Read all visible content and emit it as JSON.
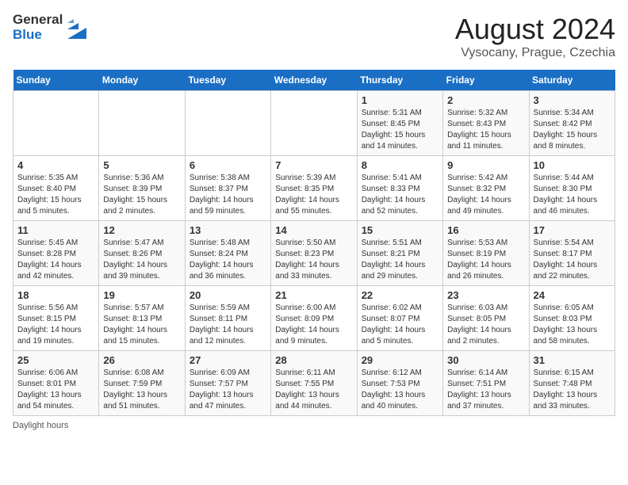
{
  "header": {
    "logo_line1": "General",
    "logo_line2": "Blue",
    "month_year": "August 2024",
    "location": "Vysocany, Prague, Czechia"
  },
  "footer": {
    "text": "Daylight hours"
  },
  "weekdays": [
    "Sunday",
    "Monday",
    "Tuesday",
    "Wednesday",
    "Thursday",
    "Friday",
    "Saturday"
  ],
  "weeks": [
    [
      {
        "day": "",
        "info": ""
      },
      {
        "day": "",
        "info": ""
      },
      {
        "day": "",
        "info": ""
      },
      {
        "day": "",
        "info": ""
      },
      {
        "day": "1",
        "info": "Sunrise: 5:31 AM\nSunset: 8:45 PM\nDaylight: 15 hours\nand 14 minutes."
      },
      {
        "day": "2",
        "info": "Sunrise: 5:32 AM\nSunset: 8:43 PM\nDaylight: 15 hours\nand 11 minutes."
      },
      {
        "day": "3",
        "info": "Sunrise: 5:34 AM\nSunset: 8:42 PM\nDaylight: 15 hours\nand 8 minutes."
      }
    ],
    [
      {
        "day": "4",
        "info": "Sunrise: 5:35 AM\nSunset: 8:40 PM\nDaylight: 15 hours\nand 5 minutes."
      },
      {
        "day": "5",
        "info": "Sunrise: 5:36 AM\nSunset: 8:39 PM\nDaylight: 15 hours\nand 2 minutes."
      },
      {
        "day": "6",
        "info": "Sunrise: 5:38 AM\nSunset: 8:37 PM\nDaylight: 14 hours\nand 59 minutes."
      },
      {
        "day": "7",
        "info": "Sunrise: 5:39 AM\nSunset: 8:35 PM\nDaylight: 14 hours\nand 55 minutes."
      },
      {
        "day": "8",
        "info": "Sunrise: 5:41 AM\nSunset: 8:33 PM\nDaylight: 14 hours\nand 52 minutes."
      },
      {
        "day": "9",
        "info": "Sunrise: 5:42 AM\nSunset: 8:32 PM\nDaylight: 14 hours\nand 49 minutes."
      },
      {
        "day": "10",
        "info": "Sunrise: 5:44 AM\nSunset: 8:30 PM\nDaylight: 14 hours\nand 46 minutes."
      }
    ],
    [
      {
        "day": "11",
        "info": "Sunrise: 5:45 AM\nSunset: 8:28 PM\nDaylight: 14 hours\nand 42 minutes."
      },
      {
        "day": "12",
        "info": "Sunrise: 5:47 AM\nSunset: 8:26 PM\nDaylight: 14 hours\nand 39 minutes."
      },
      {
        "day": "13",
        "info": "Sunrise: 5:48 AM\nSunset: 8:24 PM\nDaylight: 14 hours\nand 36 minutes."
      },
      {
        "day": "14",
        "info": "Sunrise: 5:50 AM\nSunset: 8:23 PM\nDaylight: 14 hours\nand 33 minutes."
      },
      {
        "day": "15",
        "info": "Sunrise: 5:51 AM\nSunset: 8:21 PM\nDaylight: 14 hours\nand 29 minutes."
      },
      {
        "day": "16",
        "info": "Sunrise: 5:53 AM\nSunset: 8:19 PM\nDaylight: 14 hours\nand 26 minutes."
      },
      {
        "day": "17",
        "info": "Sunrise: 5:54 AM\nSunset: 8:17 PM\nDaylight: 14 hours\nand 22 minutes."
      }
    ],
    [
      {
        "day": "18",
        "info": "Sunrise: 5:56 AM\nSunset: 8:15 PM\nDaylight: 14 hours\nand 19 minutes."
      },
      {
        "day": "19",
        "info": "Sunrise: 5:57 AM\nSunset: 8:13 PM\nDaylight: 14 hours\nand 15 minutes."
      },
      {
        "day": "20",
        "info": "Sunrise: 5:59 AM\nSunset: 8:11 PM\nDaylight: 14 hours\nand 12 minutes."
      },
      {
        "day": "21",
        "info": "Sunrise: 6:00 AM\nSunset: 8:09 PM\nDaylight: 14 hours\nand 9 minutes."
      },
      {
        "day": "22",
        "info": "Sunrise: 6:02 AM\nSunset: 8:07 PM\nDaylight: 14 hours\nand 5 minutes."
      },
      {
        "day": "23",
        "info": "Sunrise: 6:03 AM\nSunset: 8:05 PM\nDaylight: 14 hours\nand 2 minutes."
      },
      {
        "day": "24",
        "info": "Sunrise: 6:05 AM\nSunset: 8:03 PM\nDaylight: 13 hours\nand 58 minutes."
      }
    ],
    [
      {
        "day": "25",
        "info": "Sunrise: 6:06 AM\nSunset: 8:01 PM\nDaylight: 13 hours\nand 54 minutes."
      },
      {
        "day": "26",
        "info": "Sunrise: 6:08 AM\nSunset: 7:59 PM\nDaylight: 13 hours\nand 51 minutes."
      },
      {
        "day": "27",
        "info": "Sunrise: 6:09 AM\nSunset: 7:57 PM\nDaylight: 13 hours\nand 47 minutes."
      },
      {
        "day": "28",
        "info": "Sunrise: 6:11 AM\nSunset: 7:55 PM\nDaylight: 13 hours\nand 44 minutes."
      },
      {
        "day": "29",
        "info": "Sunrise: 6:12 AM\nSunset: 7:53 PM\nDaylight: 13 hours\nand 40 minutes."
      },
      {
        "day": "30",
        "info": "Sunrise: 6:14 AM\nSunset: 7:51 PM\nDaylight: 13 hours\nand 37 minutes."
      },
      {
        "day": "31",
        "info": "Sunrise: 6:15 AM\nSunset: 7:48 PM\nDaylight: 13 hours\nand 33 minutes."
      }
    ]
  ]
}
